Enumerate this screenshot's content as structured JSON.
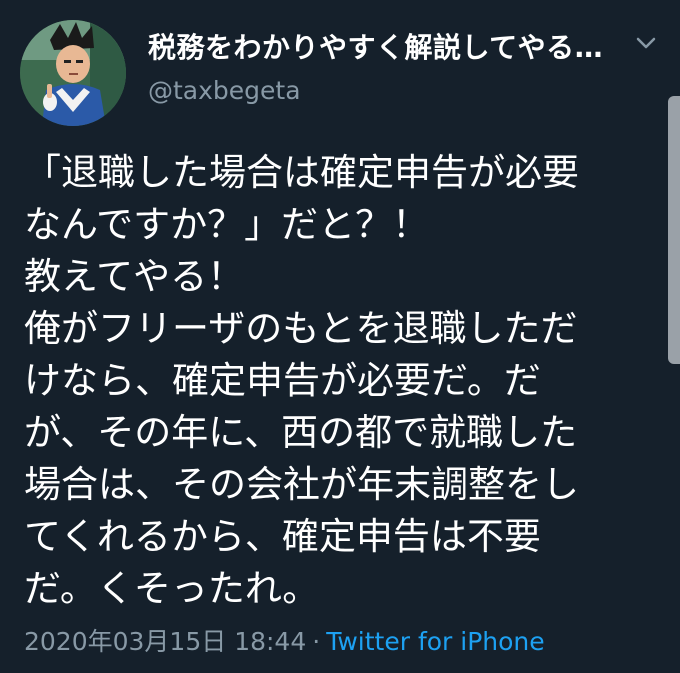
{
  "tweet": {
    "author": {
      "display_name": "税務をわかりやすく解説してやる…",
      "handle": "@taxbegeta",
      "avatar_icon": "character-avatar"
    },
    "menu_icon": "chevron-down-icon",
    "text": "「退職した場合は確定申告が必要\nなんですか？」だと？！\n教えてやる！\n俺がフリーザのもとを退職しただ\nけなら、確定申告が必要だ。だ\nが、その年に、西の都で就職した\n場合は、その会社が年末調整をし\nてくれるから、確定申告は不要\nだ。くそったれ。",
    "timestamp": "2020年03月15日 18:44",
    "separator": "·",
    "source": "Twitter for iPhone"
  },
  "colors": {
    "background": "#15202b",
    "text": "#ffffff",
    "secondary_text": "#8899a6",
    "link": "#1da1f2"
  }
}
